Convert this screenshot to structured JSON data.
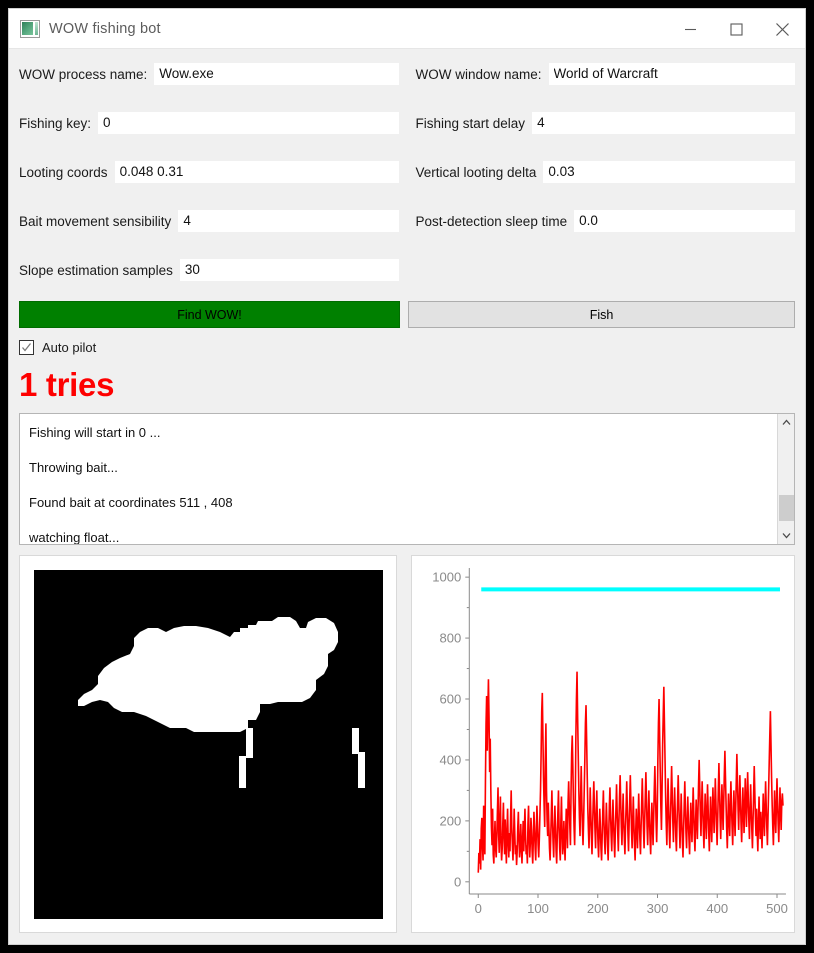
{
  "window": {
    "title": "WOW fishing bot",
    "icon": "app-picture-icon",
    "controls": {
      "minimize": "minimize-icon",
      "maximize": "maximize-icon",
      "close": "close-icon"
    }
  },
  "form": {
    "fields": [
      {
        "label": "WOW process name:",
        "value": "Wow.exe",
        "name": "wow-process-name"
      },
      {
        "label": "WOW window name:",
        "value": "World of Warcraft",
        "name": "wow-window-name"
      },
      {
        "label": "Fishing key:",
        "value": "0",
        "name": "fishing-key"
      },
      {
        "label": "Fishing start delay",
        "value": "4",
        "name": "fishing-start-delay"
      },
      {
        "label": "Looting coords",
        "value": "0.048 0.31",
        "name": "looting-coords"
      },
      {
        "label": "Vertical looting delta",
        "value": "0.03",
        "name": "vertical-looting-delta"
      },
      {
        "label": "Bait movement sensibility",
        "value": "4",
        "name": "bait-movement-sensibility"
      },
      {
        "label": "Post-detection sleep time",
        "value": "0.0",
        "name": "post-detection-sleep-time"
      },
      {
        "label": "Slope estimation samples",
        "value": "30",
        "name": "slope-estimation-samples"
      }
    ]
  },
  "buttons": {
    "find": "Find WOW!",
    "fish": "Fish"
  },
  "checkbox": {
    "label": "Auto pilot",
    "checked": true
  },
  "status": {
    "tries": "1 tries",
    "tries_color": "#fe0000"
  },
  "log": {
    "lines": [
      "Fishing will start in 0 ...",
      "Throwing bait...",
      "Found bait at coordinates 511 , 408",
      "watching float..."
    ]
  },
  "colors": {
    "accent_green": "#008000",
    "signal_red": "#fe0000",
    "threshold_cyan": "#00ffff"
  },
  "chart_data": {
    "type": "line",
    "title": "",
    "xlabel": "",
    "ylabel": "",
    "xlim": [
      -15,
      515
    ],
    "ylim": [
      -40,
      1030
    ],
    "xticks": [
      0,
      100,
      200,
      300,
      400,
      500
    ],
    "yticks": [
      0,
      200,
      400,
      600,
      800,
      1000
    ],
    "grid": false,
    "legend": "none",
    "series": [
      {
        "name": "threshold",
        "color": "#00ffff",
        "type": "hline",
        "value": 960,
        "x_start": 5,
        "x_end": 505
      },
      {
        "name": "bait movement signal",
        "color": "#fe0000",
        "type": "line",
        "x_start": 0,
        "x_end": 510,
        "values": [
          30,
          95,
          60,
          140,
          40,
          175,
          210,
          120,
          70,
          250,
          180,
          90,
          330,
          520,
          610,
          430,
          560,
          665,
          540,
          360,
          470,
          300,
          180,
          120,
          240,
          90,
          60,
          140,
          200,
          110,
          80,
          150,
          230,
          310,
          160,
          95,
          200,
          280,
          130,
          70,
          110,
          190,
          260,
          150,
          90,
          205,
          120,
          60,
          170,
          240,
          130,
          80,
          160,
          100,
          210,
          300,
          180,
          120,
          70,
          140,
          240,
          160,
          90,
          120,
          55,
          100,
          180,
          230,
          140,
          80,
          110,
          190,
          120,
          60,
          130,
          200,
          100,
          170,
          240,
          150,
          90,
          120,
          60,
          190,
          250,
          140,
          80,
          130,
          210,
          170,
          100,
          60,
          140,
          230,
          180,
          110,
          70,
          160,
          250,
          190,
          120,
          80,
          140,
          220,
          300,
          420,
          560,
          620,
          480,
          340,
          250,
          180,
          400,
          520,
          300,
          200,
          150,
          260,
          180,
          110,
          70,
          140,
          220,
          300,
          200,
          130,
          80,
          170,
          250,
          180,
          100,
          60,
          150,
          230,
          300,
          180,
          110,
          70,
          200,
          280,
          160,
          90,
          120,
          200,
          130,
          70,
          160,
          240,
          180,
          110,
          260,
          330,
          250,
          180,
          120,
          300,
          420,
          480,
          380,
          260,
          180,
          120,
          240,
          470,
          600,
          690,
          540,
          420,
          300,
          210,
          150,
          280,
          380,
          260,
          180,
          120,
          200,
          300,
          400,
          520,
          580,
          470,
          350,
          240,
          170,
          110,
          200,
          310,
          230,
          150,
          90,
          180,
          260,
          330,
          250,
          170,
          110,
          220,
          300,
          200,
          130,
          80,
          160,
          240,
          180,
          110,
          70,
          150,
          230,
          300,
          200,
          130,
          90,
          180,
          260,
          190,
          120,
          70,
          160,
          250,
          310,
          220,
          150,
          100,
          190,
          270,
          200,
          130,
          80,
          170,
          240,
          320,
          230,
          160,
          100,
          200,
          280,
          350,
          260,
          180,
          120,
          210,
          290,
          200,
          140,
          90,
          180,
          250,
          330,
          240,
          160,
          100,
          190,
          270,
          350,
          260,
          170,
          110,
          200,
          280,
          190,
          120,
          70,
          160,
          240,
          170,
          110,
          200,
          290,
          210,
          140,
          90,
          180,
          260,
          340,
          250,
          170,
          110,
          200,
          280,
          360,
          270,
          180,
          120,
          210,
          300,
          210,
          140,
          90,
          180,
          260,
          190,
          120,
          210,
          300,
          380,
          290,
          200,
          130,
          220,
          400,
          520,
          600,
          480,
          360,
          250,
          170,
          300,
          450,
          550,
          640,
          520,
          400,
          280,
          190,
          120,
          230,
          340,
          250,
          170,
          110,
          200,
          290,
          380,
          290,
          200,
          130,
          220,
          310,
          230,
          150,
          100,
          190,
          270,
          350,
          260,
          180,
          110,
          200,
          290,
          200,
          130,
          80,
          170,
          250,
          330,
          240,
          160,
          110,
          200,
          280,
          200,
          140,
          90,
          180,
          260,
          190,
          130,
          220,
          310,
          230,
          150,
          100,
          190,
          270,
          200,
          140,
          230,
          320,
          400,
          310,
          220,
          150,
          240,
          330,
          250,
          170,
          110,
          200,
          290,
          210,
          140,
          230,
          320,
          240,
          160,
          100,
          190,
          280,
          200,
          130,
          220,
          310,
          230,
          160,
          250,
          340,
          260,
          180,
          120,
          210,
          300,
          390,
          300,
          210,
          140,
          230,
          320,
          240,
          170,
          260,
          350,
          430,
          340,
          250,
          170,
          110,
          200,
          290,
          210,
          150,
          240,
          330,
          250,
          180,
          120,
          210,
          300,
          220,
          150,
          240,
          330,
          420,
          330,
          240,
          170,
          260,
          350,
          270,
          190,
          130,
          220,
          310,
          230,
          160,
          250,
          340,
          260,
          180,
          270,
          360,
          280,
          200,
          140,
          230,
          320,
          240,
          170,
          110,
          200,
          290,
          380,
          290,
          210,
          150,
          240,
          160,
          100,
          190,
          280,
          200,
          140,
          230,
          170,
          110,
          200,
          290,
          210,
          150,
          240,
          330,
          250,
          180,
          120,
          210,
          300,
          390,
          480,
          560,
          450,
          340,
          250,
          180,
          120,
          210,
          300,
          220,
          160,
          250,
          340,
          260,
          190,
          130,
          220,
          310,
          230,
          170,
          260,
          290,
          250
        ]
      }
    ]
  }
}
